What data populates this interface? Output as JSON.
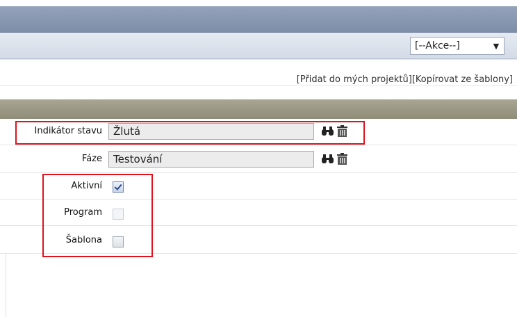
{
  "header": {
    "actions_select": {
      "value": "[--Akce--]"
    }
  },
  "links": {
    "add_to_projects": "[Přidat do mých projektů]",
    "copy_from_template": "[Kopírovat ze šablony]"
  },
  "form": {
    "status_indicator": {
      "label": "Indikátor stavu",
      "value": "Žlutá"
    },
    "phase": {
      "label": "Fáze",
      "value": "Testování"
    },
    "active": {
      "label": "Aktivní",
      "checked": true
    },
    "program": {
      "label": "Program",
      "checked": false
    },
    "template": {
      "label": "Šablona",
      "checked": false
    }
  },
  "colors": {
    "highlight": "#e0121b",
    "title_bar": "#8a9ab2",
    "section_bar": "#9c9a85"
  }
}
